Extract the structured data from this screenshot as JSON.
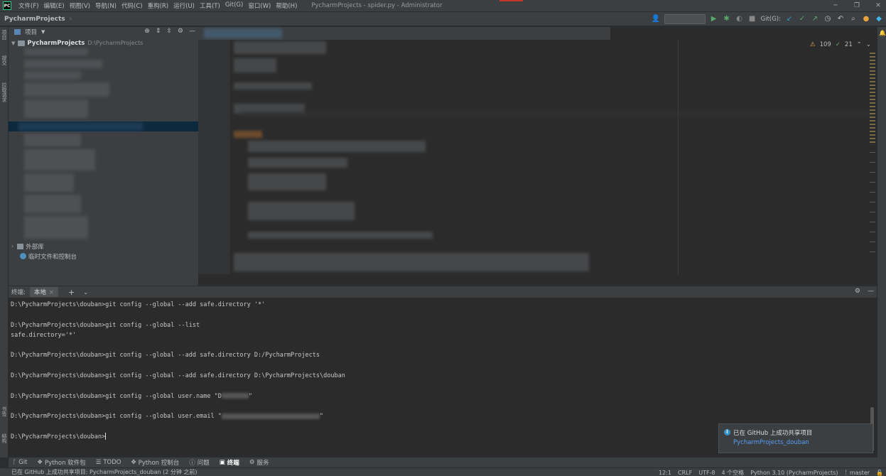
{
  "titlebar": {
    "logo": "PC",
    "menu": [
      "文件(F)",
      "编辑(E)",
      "视图(V)",
      "导航(N)",
      "代码(C)",
      "重构(R)",
      "运行(U)",
      "工具(T)",
      "Git(G)",
      "窗口(W)",
      "帮助(H)"
    ],
    "window_title": "PycharmProjects - spider.py - Administrator",
    "controls": [
      "minimize-icon",
      "restore-icon",
      "close-icon"
    ]
  },
  "navbar": {
    "breadcrumb_root": "PycharmProjects",
    "git_label": "Git(G):"
  },
  "left_strip": {
    "tabs": [
      "项目",
      "提交",
      "拉取请求",
      "书签",
      "结构"
    ]
  },
  "project_panel": {
    "header_label": "项目",
    "root_name": "PycharmProjects",
    "root_path": "D:\\PycharmProjects",
    "external_libs": "外部库",
    "scratches": "临时文件和控制台"
  },
  "editor": {
    "warnings": "109",
    "ok_count": "21"
  },
  "terminal": {
    "title": "终端:",
    "tab_label": "本地",
    "lines": [
      {
        "prompt": "D:\\PycharmProjects\\douban>",
        "cmd": "git config --global --add safe.directory '*'"
      },
      {
        "prompt": "",
        "cmd": ""
      },
      {
        "prompt": "D:\\PycharmProjects\\douban>",
        "cmd": "git config --global --list"
      },
      {
        "prompt": "",
        "cmd": "safe.directory='*'"
      },
      {
        "prompt": "",
        "cmd": ""
      },
      {
        "prompt": "D:\\PycharmProjects\\douban>",
        "cmd": "git config --global --add safe.directory D:/PycharmProjects"
      },
      {
        "prompt": "",
        "cmd": ""
      },
      {
        "prompt": "D:\\PycharmProjects\\douban>",
        "cmd": "git config --global --add safe.directory D:\\PycharmProjects\\douban"
      },
      {
        "prompt": "",
        "cmd": ""
      },
      {
        "prompt": "D:\\PycharmProjects\\douban>",
        "cmd": "git config --global user.name \"D"
      },
      {
        "prompt": "",
        "cmd": ""
      },
      {
        "prompt": "D:\\PycharmProjects\\douban>",
        "cmd": "git config --global user.email \""
      },
      {
        "prompt": "",
        "cmd": ""
      },
      {
        "prompt": "D:\\PycharmProjects\\douban>",
        "cmd": ""
      }
    ]
  },
  "notification": {
    "title": "已在 GitHub 上成功共享项目",
    "link": "PycharmProjects_douban"
  },
  "bottom_tabs": [
    {
      "icon": "git-icon",
      "label": "Git"
    },
    {
      "icon": "package-icon",
      "label": "Python 软件包"
    },
    {
      "icon": "todo-icon",
      "label": "TODO"
    },
    {
      "icon": "python-console-icon",
      "label": "Python 控制台"
    },
    {
      "icon": "problems-icon",
      "label": "问题"
    },
    {
      "icon": "terminal-icon",
      "label": "终端"
    },
    {
      "icon": "services-icon",
      "label": "服务"
    }
  ],
  "statusbar": {
    "message": "已在 GitHub 上成功共享项目: PycharmProjects_douban (2 分钟 之前)",
    "position": "12:1",
    "line_sep": "CRLF",
    "encoding": "UTF-8",
    "indent": "4 个空格",
    "interpreter": "Python 3.10 (PycharmProjects)",
    "branch": "master"
  }
}
